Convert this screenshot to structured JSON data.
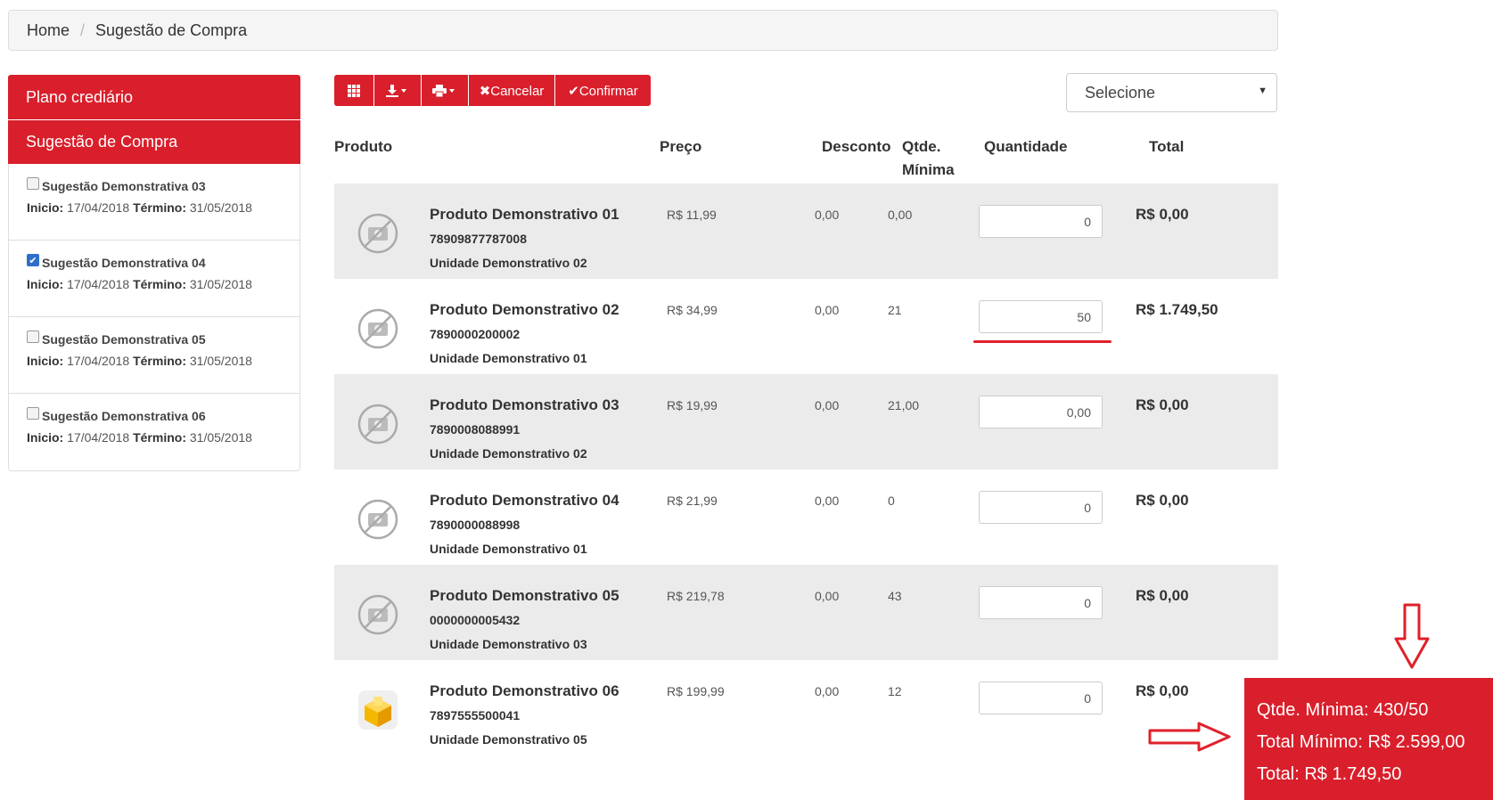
{
  "breadcrumb": {
    "home": "Home",
    "separator": "/",
    "current": "Sugestão de Compra"
  },
  "sidebar": {
    "headers": [
      "Plano crediário",
      "Sugestão de Compra"
    ],
    "start_label": "Inicio:",
    "end_label": "Término:",
    "items": [
      {
        "title": "Sugestão Demonstrativa 03",
        "checked": false,
        "start": "17/04/2018",
        "end": "31/05/2018"
      },
      {
        "title": "Sugestão Demonstrativa 04",
        "checked": true,
        "start": "17/04/2018",
        "end": "31/05/2018"
      },
      {
        "title": "Sugestão Demonstrativa 05",
        "checked": false,
        "start": "17/04/2018",
        "end": "31/05/2018"
      },
      {
        "title": "Sugestão Demonstrativa 06",
        "checked": false,
        "start": "17/04/2018",
        "end": "31/05/2018"
      }
    ]
  },
  "toolbar": {
    "grid_icon": "grid-icon",
    "download_icon": "download-icon",
    "print_icon": "print-icon",
    "cancel_label": "✖Cancelar",
    "confirm_label": "✔Confirmar"
  },
  "select": {
    "value": "Selecione"
  },
  "table": {
    "headers": {
      "produto": "Produto",
      "preco": "Preço",
      "desconto": "Desconto",
      "qtde_minima_1": "Qtde.",
      "qtde_minima_2": "Mínima",
      "quantidade": "Quantidade",
      "total": "Total"
    },
    "rows": [
      {
        "name": "Produto Demonstrativo 01",
        "code": "78909877787008",
        "unit": "Unidade Demonstrativo 02",
        "price": "R$ 11,99",
        "discount": "0,00",
        "min_qty": "0,00",
        "qty": "0",
        "total": "R$ 0,00",
        "icon": "no-photo-icon"
      },
      {
        "name": "Produto Demonstrativo 02",
        "code": "7890000200002",
        "unit": "Unidade Demonstrativo 01",
        "price": "R$ 34,99",
        "discount": "0,00",
        "min_qty": "21",
        "qty": "50",
        "total": "R$ 1.749,50",
        "icon": "no-photo-icon"
      },
      {
        "name": "Produto Demonstrativo 03",
        "code": "7890008088991",
        "unit": "Unidade Demonstrativo 02",
        "price": "R$ 19,99",
        "discount": "0,00",
        "min_qty": "21,00",
        "qty": "0,00",
        "total": "R$ 0,00",
        "icon": "no-photo-icon"
      },
      {
        "name": "Produto Demonstrativo 04",
        "code": "7890000088998",
        "unit": "Unidade Demonstrativo 01",
        "price": "R$ 21,99",
        "discount": "0,00",
        "min_qty": "0",
        "qty": "0",
        "total": "R$ 0,00",
        "icon": "no-photo-icon"
      },
      {
        "name": "Produto Demonstrativo 05",
        "code": "0000000005432",
        "unit": "Unidade Demonstrativo 03",
        "price": "R$ 219,78",
        "discount": "0,00",
        "min_qty": "43",
        "qty": "0",
        "total": "R$ 0,00",
        "icon": "no-photo-icon"
      },
      {
        "name": "Produto Demonstrativo 06",
        "code": "7897555500041",
        "unit": "Unidade Demonstrativo 05",
        "price": "R$ 199,99",
        "discount": "0,00",
        "min_qty": "12",
        "qty": "0",
        "total": "R$ 0,00",
        "icon": "product-box-icon"
      }
    ]
  },
  "summary": {
    "min_qty": "Qtde. Mínima: 430/50",
    "min_total": "Total Mínimo: R$ 2.599,00",
    "total": "Total: R$ 1.749,50"
  },
  "colors": {
    "accent": "#d91f2b",
    "row_shade": "#ebebeb",
    "annotation": "#e0202a"
  }
}
